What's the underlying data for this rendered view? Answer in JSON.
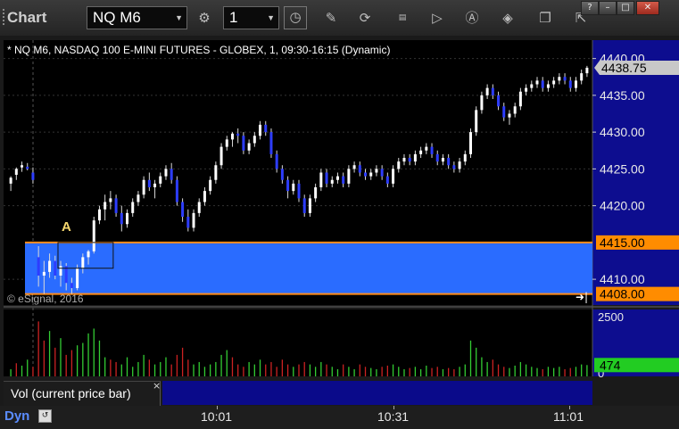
{
  "toolbar": {
    "app_title": "Chart",
    "symbol": "NQ M6",
    "interval": "1",
    "window_buttons": [
      "?",
      "–",
      "□",
      "✕"
    ]
  },
  "chart": {
    "header": "* NQ M6, NASDAQ 100 E-MINI FUTURES - GLOBEX, 1, 09:30-16:15 (Dynamic)",
    "copyright": "© eSignal, 2016",
    "annotation": "A"
  },
  "volume_pane": {
    "label": "Vol (current price bar)",
    "close": "×"
  },
  "bottom": {
    "mode": "Dyn"
  },
  "chart_data": [
    {
      "type": "candlestick",
      "title": "NQ M6",
      "y_ticks": [
        "4440.00",
        "4435.00",
        "4430.00",
        "4425.00",
        "4420.00",
        "4415.00",
        "4410.00",
        "4408.00"
      ],
      "ylim": [
        4406.5,
        4442.5
      ],
      "last_price": "4438.75",
      "zone": {
        "high": 4415.0,
        "low": 4408.0,
        "high_label": "4415.00",
        "low_label": "4408.00",
        "color": "#2a6cff"
      },
      "x_ticks": [
        "10:01",
        "10:31",
        "11:01"
      ],
      "annotation_label": "A",
      "annotation_box": {
        "start_bar": 9,
        "end_bar": 18,
        "high": 4415.0,
        "low": 4411.5
      },
      "colors": {
        "up": "#ffffff",
        "down": "#2d3dff",
        "wick": "#d8d8d8"
      },
      "bars": [
        [
          4423.0,
          4424.0,
          4422.0,
          4423.8
        ],
        [
          4424.2,
          4425.2,
          4423.5,
          4425.0
        ],
        [
          4425.2,
          4426.0,
          4424.6,
          4425.5
        ],
        [
          4425.3,
          4425.8,
          4424.8,
          4425.0
        ],
        [
          4424.5,
          4425.2,
          4423.0,
          4423.5
        ],
        [
          4413.0,
          4414.5,
          4409.0,
          4410.5
        ],
        [
          4410.5,
          4412.5,
          4408.0,
          4411.0
        ],
        [
          4411.0,
          4413.5,
          4410.2,
          4412.5
        ],
        [
          4412.5,
          4413.2,
          4410.0,
          4410.5
        ],
        [
          4410.5,
          4412.5,
          4409.0,
          4411.8
        ],
        [
          4411.8,
          4412.2,
          4408.5,
          4409.5
        ],
        [
          4409.5,
          4410.2,
          4408.0,
          4408.8
        ],
        [
          4408.8,
          4412.0,
          4408.5,
          4411.5
        ],
        [
          4411.5,
          4413.5,
          4410.8,
          4413.0
        ],
        [
          4413.0,
          4414.0,
          4412.0,
          4413.8
        ],
        [
          4413.8,
          4418.5,
          4413.5,
          4418.0
        ],
        [
          4418.0,
          4420.0,
          4417.5,
          4419.5
        ],
        [
          4419.5,
          4421.5,
          4418.0,
          4420.5
        ],
        [
          4420.5,
          4422.0,
          4419.5,
          4421.0
        ],
        [
          4421.0,
          4421.5,
          4418.5,
          4419.0
        ],
        [
          4419.0,
          4420.0,
          4416.5,
          4417.5
        ],
        [
          4417.5,
          4419.5,
          4417.0,
          4419.0
        ],
        [
          4419.0,
          4421.0,
          4418.5,
          4420.5
        ],
        [
          4420.5,
          4422.0,
          4420.0,
          4421.5
        ],
        [
          4421.5,
          4424.0,
          4421.0,
          4423.5
        ],
        [
          4423.5,
          4424.5,
          4422.0,
          4422.5
        ],
        [
          4422.5,
          4423.5,
          4421.0,
          4423.0
        ],
        [
          4423.0,
          4424.5,
          4422.5,
          4424.0
        ],
        [
          4424.0,
          4425.5,
          4423.5,
          4425.0
        ],
        [
          4425.0,
          4425.8,
          4423.0,
          4423.5
        ],
        [
          4423.5,
          4424.0,
          4420.0,
          4420.5
        ],
        [
          4420.5,
          4421.0,
          4417.8,
          4418.5
        ],
        [
          4418.5,
          4419.5,
          4416.5,
          4417.0
        ],
        [
          4417.0,
          4419.5,
          4416.5,
          4419.0
        ],
        [
          4419.0,
          4421.0,
          4418.5,
          4420.5
        ],
        [
          4420.5,
          4422.5,
          4420.0,
          4422.0
        ],
        [
          4422.0,
          4424.0,
          4421.5,
          4423.5
        ],
        [
          4423.5,
          4426.0,
          4423.0,
          4425.5
        ],
        [
          4425.5,
          4428.5,
          4425.0,
          4428.0
        ],
        [
          4428.0,
          4429.5,
          4427.5,
          4429.0
        ],
        [
          4429.0,
          4430.0,
          4428.0,
          4429.8
        ],
        [
          4429.8,
          4430.5,
          4428.5,
          4429.5
        ],
        [
          4429.5,
          4430.0,
          4427.0,
          4427.5
        ],
        [
          4427.5,
          4429.0,
          4427.0,
          4428.5
        ],
        [
          4428.5,
          4430.0,
          4428.0,
          4429.5
        ],
        [
          4429.5,
          4431.5,
          4429.0,
          4431.0
        ],
        [
          4431.0,
          4431.5,
          4429.5,
          4430.0
        ],
        [
          4430.0,
          4430.5,
          4426.5,
          4427.0
        ],
        [
          4427.0,
          4427.5,
          4424.5,
          4425.0
        ],
        [
          4425.0,
          4425.5,
          4423.0,
          4423.5
        ],
        [
          4423.5,
          4424.0,
          4421.0,
          4422.0
        ],
        [
          4422.0,
          4423.5,
          4421.5,
          4423.0
        ],
        [
          4423.0,
          4423.5,
          4420.5,
          4421.0
        ],
        [
          4421.0,
          4421.5,
          4418.5,
          4419.0
        ],
        [
          4419.0,
          4421.5,
          4418.5,
          4421.0
        ],
        [
          4421.0,
          4423.0,
          4420.5,
          4422.5
        ],
        [
          4422.5,
          4425.0,
          4422.0,
          4424.5
        ],
        [
          4424.5,
          4425.0,
          4422.5,
          4423.0
        ],
        [
          4423.0,
          4424.0,
          4422.5,
          4423.5
        ],
        [
          4423.5,
          4424.5,
          4423.0,
          4424.0
        ],
        [
          4424.0,
          4424.5,
          4422.5,
          4423.0
        ],
        [
          4423.0,
          4425.5,
          4422.5,
          4425.0
        ],
        [
          4425.0,
          4426.0,
          4424.5,
          4425.5
        ],
        [
          4425.5,
          4426.0,
          4424.0,
          4424.5
        ],
        [
          4424.5,
          4425.0,
          4423.5,
          4424.0
        ],
        [
          4424.0,
          4425.0,
          4423.5,
          4424.5
        ],
        [
          4424.5,
          4425.5,
          4424.0,
          4425.0
        ],
        [
          4425.0,
          4425.5,
          4423.5,
          4424.0
        ],
        [
          4424.0,
          4424.5,
          4422.5,
          4423.0
        ],
        [
          4423.0,
          4425.5,
          4422.5,
          4425.0
        ],
        [
          4425.0,
          4426.5,
          4424.5,
          4426.0
        ],
        [
          4426.0,
          4427.0,
          4425.5,
          4426.5
        ],
        [
          4426.5,
          4427.0,
          4425.5,
          4426.0
        ],
        [
          4426.0,
          4427.5,
          4425.5,
          4427.0
        ],
        [
          4427.0,
          4428.0,
          4426.5,
          4427.5
        ],
        [
          4427.5,
          4428.5,
          4427.0,
          4428.0
        ],
        [
          4428.0,
          4428.5,
          4426.5,
          4427.0
        ],
        [
          4427.0,
          4427.5,
          4425.5,
          4426.0
        ],
        [
          4426.0,
          4427.0,
          4425.5,
          4426.5
        ],
        [
          4426.5,
          4427.0,
          4425.0,
          4425.5
        ],
        [
          4425.5,
          4426.0,
          4424.5,
          4425.0
        ],
        [
          4425.0,
          4426.5,
          4424.5,
          4426.0
        ],
        [
          4426.0,
          4427.5,
          4425.5,
          4427.0
        ],
        [
          4427.0,
          4430.5,
          4426.5,
          4430.0
        ],
        [
          4430.0,
          4433.5,
          4429.5,
          4433.0
        ],
        [
          4433.0,
          4435.5,
          4432.5,
          4435.0
        ],
        [
          4435.0,
          4436.5,
          4434.5,
          4436.0
        ],
        [
          4436.0,
          4436.5,
          4434.5,
          4435.0
        ],
        [
          4435.0,
          4435.5,
          4433.0,
          4433.5
        ],
        [
          4433.5,
          4434.0,
          4431.5,
          4432.0
        ],
        [
          4432.0,
          4433.0,
          4431.0,
          4432.5
        ],
        [
          4432.5,
          4434.0,
          4432.0,
          4433.5
        ],
        [
          4433.5,
          4436.0,
          4433.0,
          4435.5
        ],
        [
          4435.5,
          4436.5,
          4435.0,
          4436.0
        ],
        [
          4436.0,
          4437.0,
          4435.5,
          4436.5
        ],
        [
          4436.5,
          4437.5,
          4436.0,
          4437.0
        ],
        [
          4437.0,
          4437.5,
          4435.5,
          4436.0
        ],
        [
          4436.0,
          4437.0,
          4435.5,
          4436.5
        ],
        [
          4436.5,
          4437.5,
          4436.0,
          4437.0
        ],
        [
          4437.0,
          4438.0,
          4436.5,
          4437.5
        ],
        [
          4437.5,
          4438.0,
          4436.5,
          4437.0
        ],
        [
          4437.0,
          4437.5,
          4435.5,
          4436.0
        ],
        [
          4436.0,
          4437.5,
          4435.5,
          4437.0
        ],
        [
          4437.0,
          4438.5,
          4436.5,
          4438.0
        ],
        [
          4438.0,
          4439.0,
          4437.5,
          4438.75
        ]
      ]
    },
    {
      "type": "bar",
      "title": "Vol (current price bar)",
      "y_ticks": [
        "2500",
        "0"
      ],
      "ylim": [
        0,
        2800
      ],
      "last_value": "474",
      "colors": {
        "up": "#33cc33",
        "down": "#cc2222"
      },
      "values": [
        [
          300,
          1
        ],
        [
          550,
          0
        ],
        [
          450,
          1
        ],
        [
          700,
          1
        ],
        [
          400,
          0
        ],
        [
          2300,
          0
        ],
        [
          1500,
          0
        ],
        [
          1900,
          1
        ],
        [
          1200,
          0
        ],
        [
          1600,
          1
        ],
        [
          900,
          0
        ],
        [
          1100,
          0
        ],
        [
          1300,
          1
        ],
        [
          1400,
          1
        ],
        [
          1800,
          1
        ],
        [
          2000,
          1
        ],
        [
          1500,
          1
        ],
        [
          800,
          1
        ],
        [
          700,
          0
        ],
        [
          600,
          0
        ],
        [
          500,
          1
        ],
        [
          800,
          1
        ],
        [
          400,
          1
        ],
        [
          600,
          1
        ],
        [
          900,
          1
        ],
        [
          700,
          0
        ],
        [
          500,
          1
        ],
        [
          600,
          1
        ],
        [
          800,
          1
        ],
        [
          500,
          0
        ],
        [
          900,
          0
        ],
        [
          1200,
          0
        ],
        [
          700,
          0
        ],
        [
          500,
          1
        ],
        [
          600,
          1
        ],
        [
          400,
          1
        ],
        [
          500,
          1
        ],
        [
          600,
          1
        ],
        [
          900,
          1
        ],
        [
          1100,
          1
        ],
        [
          800,
          0
        ],
        [
          500,
          0
        ],
        [
          400,
          0
        ],
        [
          600,
          1
        ],
        [
          500,
          1
        ],
        [
          700,
          1
        ],
        [
          500,
          0
        ],
        [
          600,
          0
        ],
        [
          400,
          0
        ],
        [
          700,
          0
        ],
        [
          500,
          0
        ],
        [
          400,
          1
        ],
        [
          500,
          0
        ],
        [
          600,
          0
        ],
        [
          500,
          1
        ],
        [
          400,
          1
        ],
        [
          600,
          1
        ],
        [
          500,
          0
        ],
        [
          400,
          1
        ],
        [
          300,
          1
        ],
        [
          500,
          0
        ],
        [
          400,
          1
        ],
        [
          300,
          1
        ],
        [
          500,
          0
        ],
        [
          400,
          0
        ],
        [
          350,
          1
        ],
        [
          300,
          1
        ],
        [
          400,
          0
        ],
        [
          450,
          0
        ],
        [
          500,
          1
        ],
        [
          400,
          1
        ],
        [
          300,
          1
        ],
        [
          350,
          0
        ],
        [
          400,
          1
        ],
        [
          300,
          1
        ],
        [
          450,
          1
        ],
        [
          350,
          0
        ],
        [
          400,
          0
        ],
        [
          300,
          1
        ],
        [
          350,
          0
        ],
        [
          300,
          0
        ],
        [
          400,
          1
        ],
        [
          500,
          1
        ],
        [
          1500,
          1
        ],
        [
          1200,
          1
        ],
        [
          800,
          1
        ],
        [
          600,
          1
        ],
        [
          700,
          0
        ],
        [
          500,
          0
        ],
        [
          400,
          0
        ],
        [
          350,
          1
        ],
        [
          450,
          1
        ],
        [
          600,
          1
        ],
        [
          500,
          1
        ],
        [
          400,
          1
        ],
        [
          350,
          1
        ],
        [
          300,
          0
        ],
        [
          400,
          1
        ],
        [
          350,
          1
        ],
        [
          400,
          1
        ],
        [
          300,
          0
        ],
        [
          350,
          0
        ],
        [
          400,
          1
        ],
        [
          500,
          1
        ],
        [
          474,
          1
        ]
      ]
    }
  ]
}
